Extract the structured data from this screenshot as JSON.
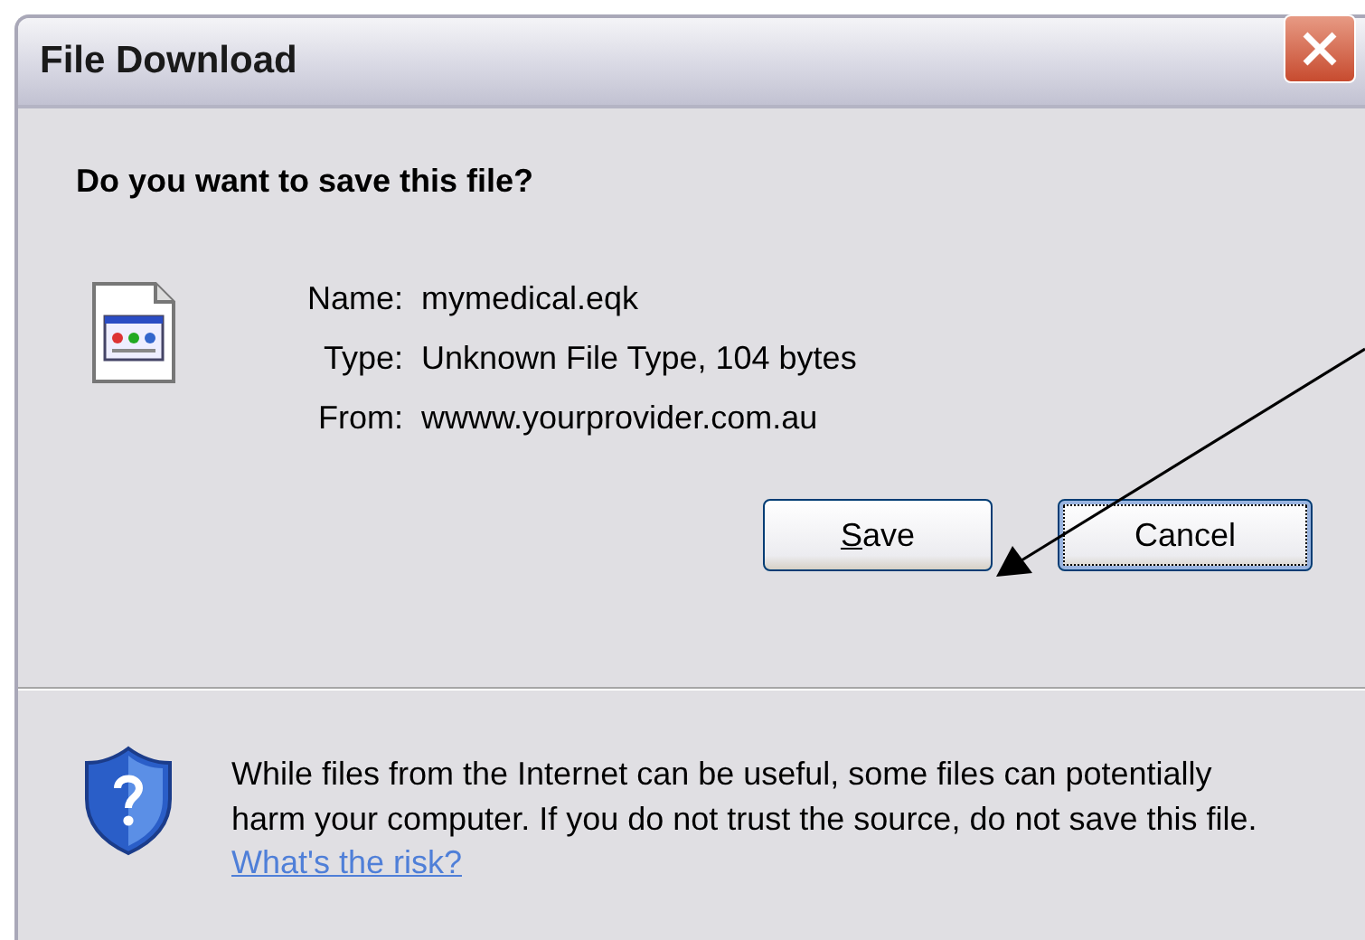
{
  "window": {
    "title": "File Download"
  },
  "question": "Do you want to save this file?",
  "details": [
    {
      "label": "Name:",
      "value": "mymedical.eqk"
    },
    {
      "label": "Type:",
      "value": "Unknown File Type, 104 bytes"
    },
    {
      "label": "From:",
      "value": "wwww.yourprovider.com.au"
    }
  ],
  "buttons": [
    {
      "label": "Save",
      "mnemonic": true,
      "focused": false
    },
    {
      "label": "Cancel",
      "mnemonic": false,
      "focused": true
    }
  ],
  "warning": {
    "text": "While files from the Internet can be useful, some files can potentially harm your computer. If you do not trust the source, do not save this file.",
    "link": "What's the risk?"
  }
}
